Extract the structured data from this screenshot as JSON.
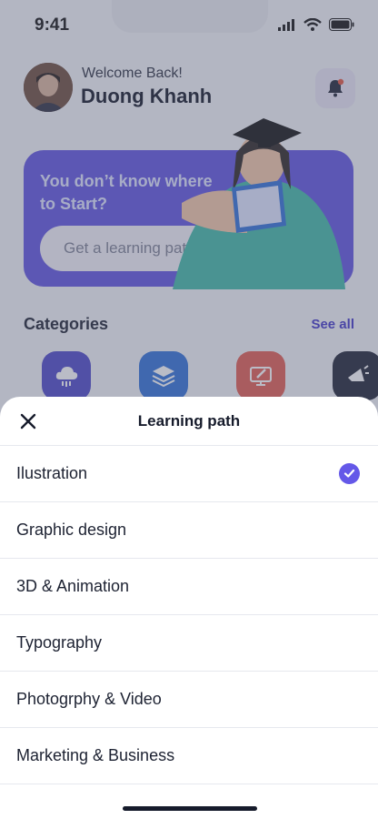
{
  "status_bar": {
    "time": "9:41",
    "icons": [
      "signal-icon",
      "wifi-icon",
      "battery-icon"
    ]
  },
  "header": {
    "welcome": "Welcome Back!",
    "username": "Duong Khanh",
    "notification_icon": "bell-icon"
  },
  "banner": {
    "title": "You don’t know where to Start?",
    "select_label": "Get a learning path",
    "select_icon": "chevron-down-icon"
  },
  "categories": {
    "title": "Categories",
    "see_all": "See all",
    "items": [
      {
        "icon": "cloud-icon",
        "color": "#4b45c9"
      },
      {
        "icon": "layers-icon",
        "color": "#2e6fd8"
      },
      {
        "icon": "design-monitor-icon",
        "color": "#e25a4f"
      },
      {
        "icon": "megaphone-icon",
        "color": "#1d2232"
      }
    ]
  },
  "sheet": {
    "title": "Learning path",
    "close_icon": "close-icon",
    "options": [
      {
        "label": "Ilustration",
        "selected": true
      },
      {
        "label": "Graphic design",
        "selected": false
      },
      {
        "label": "3D & Animation",
        "selected": false
      },
      {
        "label": "Typography",
        "selected": false
      },
      {
        "label": "Photogrphy & Video",
        "selected": false
      },
      {
        "label": "Marketing & Business",
        "selected": false
      }
    ]
  },
  "colors": {
    "accent": "#6458e8",
    "banner": "#5d52e0",
    "text_dark": "#161b2b"
  }
}
